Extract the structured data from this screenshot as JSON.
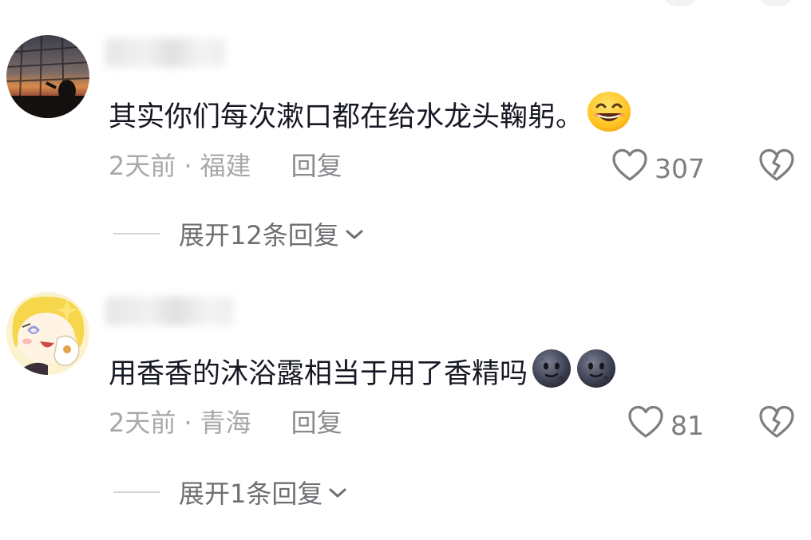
{
  "comments": [
    {
      "text": "其实你们每次漱口都在给水龙头鞠躬。",
      "emoji_icons": [
        "grinning-face-icon"
      ],
      "time": "2天前",
      "location": "福建",
      "reply_label": "回复",
      "likes": "307",
      "expand_label": "展开12条回复"
    },
    {
      "text": "用香香的沐浴露相当于用了香精吗",
      "emoji_icons": [
        "new-moon-face-icon",
        "new-moon-face-icon"
      ],
      "time": "2天前",
      "location": "青海",
      "reply_label": "回复",
      "likes": "81",
      "expand_label": "展开1条回复"
    }
  ],
  "separator": "·",
  "colors": {
    "text": "#161823",
    "meta": "#a8a8ab",
    "icon": "#7d7d82"
  }
}
